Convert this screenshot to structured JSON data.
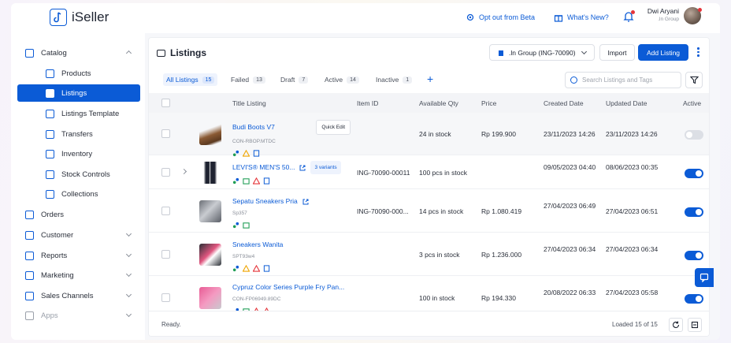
{
  "app": {
    "name": "iSeller"
  },
  "header": {
    "opt_out": "Opt out from Beta",
    "whats_new": "What's New?",
    "user_name": "Dwi Aryani",
    "user_org": ".ln Group"
  },
  "sidebar": {
    "items": [
      {
        "label": "Catalog",
        "icon": "catalog-icon"
      },
      {
        "label": "Products",
        "icon": "products-icon"
      },
      {
        "label": "Listings",
        "icon": "listings-icon"
      },
      {
        "label": "Listings Template",
        "icon": "listings-template-icon"
      },
      {
        "label": "Transfers",
        "icon": "transfers-icon"
      },
      {
        "label": "Inventory",
        "icon": "inventory-icon"
      },
      {
        "label": "Stock Controls",
        "icon": "stock-controls-icon"
      },
      {
        "label": "Collections",
        "icon": "collections-icon"
      },
      {
        "label": "Orders",
        "icon": "orders-icon"
      },
      {
        "label": "Customer",
        "icon": "customer-icon"
      },
      {
        "label": "Reports",
        "icon": "reports-icon"
      },
      {
        "label": "Marketing",
        "icon": "marketing-icon"
      },
      {
        "label": "Sales Channels",
        "icon": "sales-channels-icon"
      },
      {
        "label": "Apps",
        "icon": "apps-icon"
      }
    ]
  },
  "main": {
    "title": "Listings",
    "store_select": ".ln Group (ING-70090)",
    "import_label": "Import",
    "add_label": "Add Listing",
    "tabs": [
      {
        "label": "All Listings",
        "count": "15"
      },
      {
        "label": "Failed",
        "count": "13"
      },
      {
        "label": "Draft",
        "count": "7"
      },
      {
        "label": "Active",
        "count": "14"
      },
      {
        "label": "Inactive",
        "count": "1"
      }
    ],
    "plus": "+",
    "search_placeholder": "Search Listings and Tags",
    "columns": [
      "Title Listing",
      "Item ID",
      "Available Qty",
      "Price",
      "Created Date",
      "Updated Date",
      "Active"
    ],
    "rows": [
      {
        "title": "Budi Boots V7",
        "sku": "CON-RBOP.MTDC",
        "quick_edit": "Quick Edit",
        "item_id": "",
        "qty": "24 in stock",
        "price": "Rp 199.900",
        "created": "23/11/2023 14:26",
        "updated": "23/11/2023 14:26",
        "active": false
      },
      {
        "title": "LEVI'S® MEN'S 50...",
        "variants": "3 variants",
        "item_id": "ING-70090-00011",
        "qty": "100 pcs in stock",
        "price": "",
        "created": "09/05/2023 04:40",
        "updated": "08/06/2023 00:35",
        "active": true
      },
      {
        "title": "Sepatu Sneakers Pria",
        "sku": "Sp357",
        "item_id": "ING-70090-000...",
        "qty": "14 pcs in stock",
        "price": "Rp 1.080.419",
        "created": "27/04/2023 06:49",
        "updated": "27/04/2023 06:51",
        "active": true
      },
      {
        "title": "Sneakers Wanita",
        "sku": "SPT93w4",
        "item_id": "",
        "qty": "3 pcs in stock",
        "price": "Rp 1.236.000",
        "created": "27/04/2023 06:34",
        "updated": "27/04/2023 06:34",
        "active": true
      },
      {
        "title": "Cypruz Color Series Purple Fry Pan...",
        "sku": "CON-FP06949.89DC",
        "item_id": "",
        "qty": "100 in stock",
        "price": "Rp 194.330",
        "created": "20/08/2022 06:33",
        "updated": "27/04/2023 05:58",
        "active": true
      }
    ],
    "status": "Ready.",
    "loaded": "Loaded 15 of 15"
  },
  "colors": {
    "accent": "#0b5bd6",
    "warn": "#f0a500",
    "danger": "#e5343a",
    "green": "#1f9d55"
  }
}
